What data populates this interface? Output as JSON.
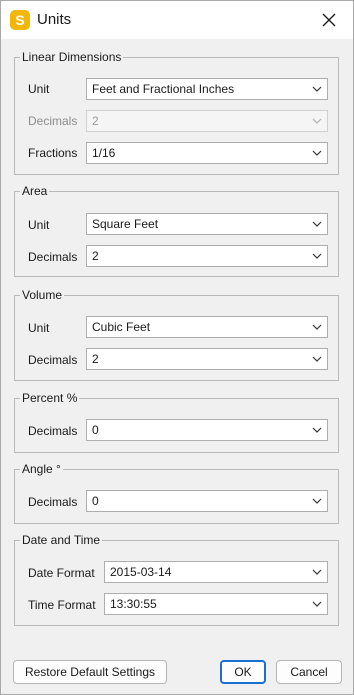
{
  "window": {
    "title": "Units",
    "app_icon_letter": "S",
    "brand_color": "#f2b705",
    "accent_color": "#1b6fd1"
  },
  "linear": {
    "group_label": "Linear Dimensions",
    "unit_label": "Unit",
    "unit_value": "Feet and Fractional Inches",
    "decimals_label": "Decimals",
    "decimals_value": "2",
    "fractions_label": "Fractions",
    "fractions_value": "1/16"
  },
  "area": {
    "group_label": "Area",
    "unit_label": "Unit",
    "unit_value": "Square Feet",
    "decimals_label": "Decimals",
    "decimals_value": "2"
  },
  "volume": {
    "group_label": "Volume",
    "unit_label": "Unit",
    "unit_value": "Cubic Feet",
    "decimals_label": "Decimals",
    "decimals_value": "2"
  },
  "percent": {
    "group_label": "Percent %",
    "decimals_label": "Decimals",
    "decimals_value": "0"
  },
  "angle": {
    "group_label": "Angle °",
    "decimals_label": "Decimals",
    "decimals_value": "0"
  },
  "datetime": {
    "group_label": "Date and Time",
    "date_format_label": "Date Format",
    "date_format_value": "2015-03-14",
    "time_format_label": "Time Format",
    "time_format_value": "13:30:55"
  },
  "footer": {
    "restore_label": "Restore Default Settings",
    "ok_label": "OK",
    "cancel_label": "Cancel"
  }
}
